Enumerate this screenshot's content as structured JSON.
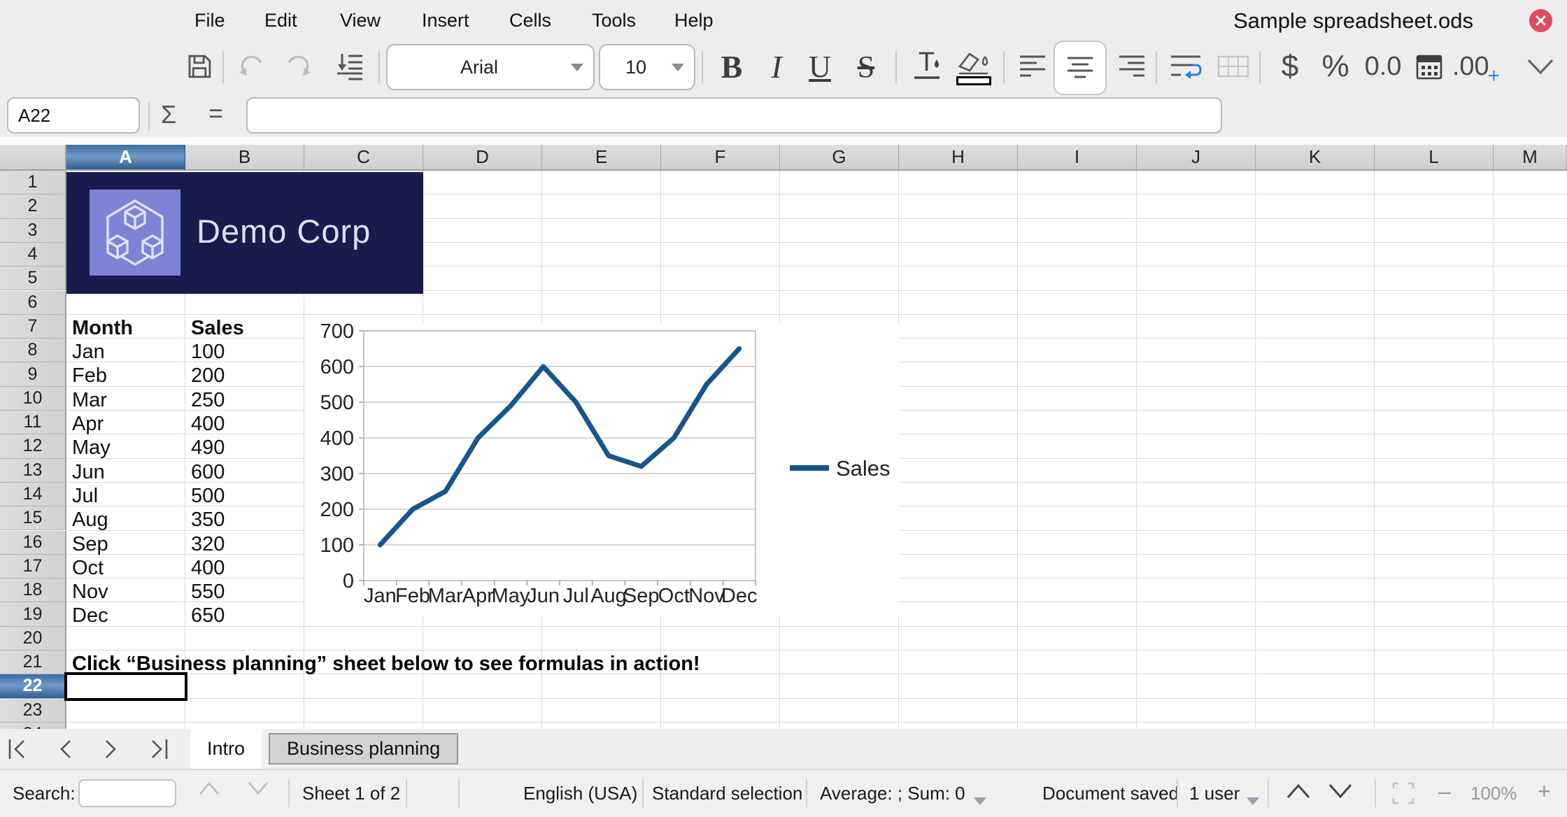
{
  "window": {
    "title": "Sample spreadsheet.ods"
  },
  "menu": {
    "items": [
      "File",
      "Edit",
      "View",
      "Insert",
      "Cells",
      "Tools",
      "Help"
    ]
  },
  "toolbar": {
    "font_name": "Arial",
    "font_size": "10",
    "bold_label": "B",
    "italic_label": "I",
    "underline_label": "U",
    "strikethrough_label": "S",
    "currency_label": "$",
    "percent_label": "%",
    "decimal_label": "0.0",
    "add_decimal_label": ".00",
    "add_decimal_plus": "+",
    "icons": [
      "save",
      "undo",
      "redo",
      "move-down",
      "font-name-combo",
      "font-size-combo",
      "bold",
      "italic",
      "underline",
      "strikethrough",
      "font-color",
      "highlight-color",
      "align-left",
      "align-center",
      "align-right",
      "wrap-text",
      "merge-cells",
      "currency-format",
      "percent-format",
      "decimal-format",
      "date-format",
      "add-decimal-place",
      "more-options"
    ]
  },
  "formula_bar": {
    "cell_reference": "A22",
    "sum_label": "Σ",
    "equals_label": "=",
    "formula_value": ""
  },
  "sheet": {
    "columns": [
      "A",
      "B",
      "C",
      "D",
      "E",
      "F",
      "G",
      "H",
      "I",
      "J",
      "K",
      "L",
      "M"
    ],
    "visible_rows": 24,
    "selected_cell": "A22",
    "selected_column": "A",
    "selected_row": 22,
    "banner_text": "Demo Corp",
    "table": {
      "start_row": 7,
      "headers": [
        "Month",
        "Sales"
      ],
      "rows": [
        [
          "Jan",
          "100"
        ],
        [
          "Feb",
          "200"
        ],
        [
          "Mar",
          "250"
        ],
        [
          "Apr",
          "400"
        ],
        [
          "May",
          "490"
        ],
        [
          "Jun",
          "600"
        ],
        [
          "Jul",
          "500"
        ],
        [
          "Aug",
          "350"
        ],
        [
          "Sep",
          "320"
        ],
        [
          "Oct",
          "400"
        ],
        [
          "Nov",
          "550"
        ],
        [
          "Dec",
          "650"
        ]
      ]
    },
    "note_row": 21,
    "note": "Click “Business planning” sheet below to see formulas in action!"
  },
  "chart_data": {
    "type": "line",
    "categories": [
      "Jan",
      "Feb",
      "Mar",
      "Apr",
      "May",
      "Jun",
      "Jul",
      "Aug",
      "Sep",
      "Oct",
      "Nov",
      "Dec"
    ],
    "series": [
      {
        "name": "Sales",
        "values": [
          100,
          200,
          250,
          400,
          490,
          600,
          500,
          350,
          320,
          400,
          550,
          650
        ],
        "color": "#17558c"
      }
    ],
    "title": "",
    "xlabel": "",
    "ylabel": "",
    "ylim": [
      0,
      700
    ],
    "ytick_step": 100,
    "grid": true,
    "legend_position": "right"
  },
  "sheet_bar": {
    "tabs": [
      {
        "label": "Intro",
        "active": true
      },
      {
        "label": "Business planning",
        "active": false
      }
    ]
  },
  "status_bar": {
    "search_label": "Search:",
    "search_value": "",
    "sheet_info": "Sheet 1 of 2",
    "language": "English (USA)",
    "selection_mode": "Standard selection",
    "stats": "Average: ; Sum: 0",
    "doc_status": "Document saved",
    "users": "1 user",
    "zoom_level": "100%",
    "zoom_out": "–",
    "zoom_in": "+"
  },
  "colors": {
    "accent_blue": "#2f7fe0",
    "chart_line": "#17558c",
    "banner_bg": "#191b4d",
    "banner_logo_bg": "#7e83d6",
    "close_red": "#e24b5e",
    "selected_header_top": "#3a6da3",
    "selected_header_mid": "#7298c6",
    "selected_header_bottom": "#2c5e94"
  }
}
